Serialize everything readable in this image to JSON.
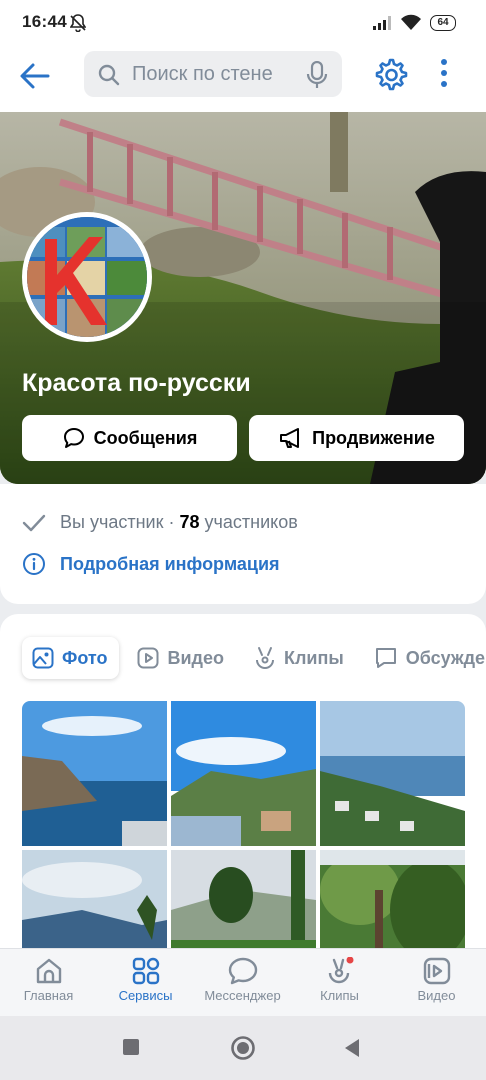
{
  "status_bar": {
    "time": "16:44",
    "battery": "64"
  },
  "search": {
    "placeholder": "Поиск по стене"
  },
  "group": {
    "name": "Красота по-русски"
  },
  "actions": {
    "messages_label": "Сообщения",
    "promotion_label": "Продвижение"
  },
  "membership": {
    "status": "Вы участник",
    "separator": "·",
    "count": "78",
    "count_suffix": "участников"
  },
  "details": {
    "label": "Подробная информация"
  },
  "media_tabs": [
    {
      "label": "Фото",
      "icon": "photo-icon",
      "active": true
    },
    {
      "label": "Видео",
      "icon": "video-icon",
      "active": false
    },
    {
      "label": "Клипы",
      "icon": "clips-icon",
      "active": false
    },
    {
      "label": "Обсуждения",
      "icon": "discussion-icon",
      "active": false
    }
  ],
  "bottom_nav": [
    {
      "label": "Главная",
      "icon": "home-icon",
      "active": false
    },
    {
      "label": "Сервисы",
      "icon": "services-icon",
      "active": true
    },
    {
      "label": "Мессенджер",
      "icon": "messenger-icon",
      "active": false
    },
    {
      "label": "Клипы",
      "icon": "clips-icon",
      "active": false,
      "badge": true
    },
    {
      "label": "Видео",
      "icon": "video-icon",
      "active": false
    }
  ],
  "colors": {
    "accent": "#2a73c7",
    "muted": "#818c99",
    "badge": "#e64646"
  }
}
